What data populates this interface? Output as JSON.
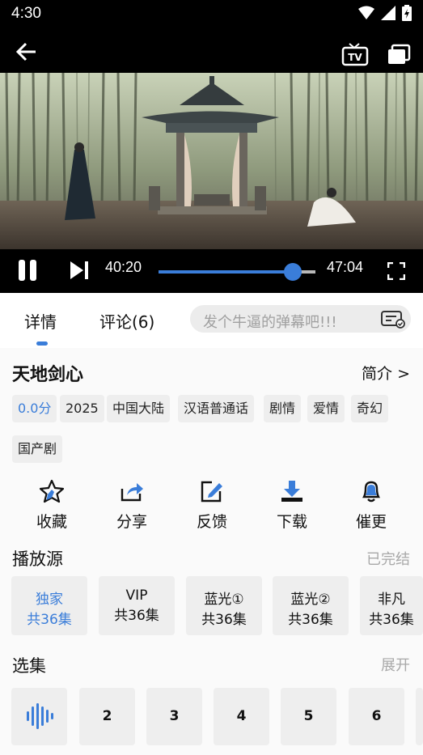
{
  "status_bar": {
    "time": "4:30"
  },
  "player": {
    "current_time": "40:20",
    "total_time": "47:04",
    "progress_fraction": 0.857
  },
  "tabs": [
    {
      "label": "详情",
      "active": true
    },
    {
      "label": "评论(6)",
      "active": false
    }
  ],
  "danmaku": {
    "placeholder": "发个牛逼的弹幕吧!!!"
  },
  "show": {
    "title": "天地剑心",
    "intro_link": "简介 >",
    "tags": [
      "0.0分",
      "2025",
      "中国大陆",
      "汉语普通话",
      "剧情",
      "爱情",
      "奇幻",
      "国产剧"
    ]
  },
  "actions": [
    {
      "label": "收藏",
      "icon": "star-icon"
    },
    {
      "label": "分享",
      "icon": "share-icon"
    },
    {
      "label": "反馈",
      "icon": "feedback-icon"
    },
    {
      "label": "下载",
      "icon": "download-icon"
    },
    {
      "label": "催更",
      "icon": "bell-icon"
    }
  ],
  "sources": {
    "title": "播放源",
    "status": "已完结",
    "items": [
      {
        "name": "独家",
        "count": "共36集",
        "active": true
      },
      {
        "name": "VIP",
        "count": "共36集",
        "active": false
      },
      {
        "name": "蓝光①",
        "count": "共36集",
        "active": false
      },
      {
        "name": "蓝光②",
        "count": "共36集",
        "active": false
      },
      {
        "name": "非凡",
        "count": "共36集",
        "active": false
      }
    ]
  },
  "episodes": {
    "title": "选集",
    "expand": "展开",
    "items": [
      "1",
      "2",
      "3",
      "4",
      "5",
      "6"
    ],
    "playing": "1"
  },
  "colors": {
    "accent": "#3a7dd9",
    "chip_bg": "#eeeeee"
  }
}
